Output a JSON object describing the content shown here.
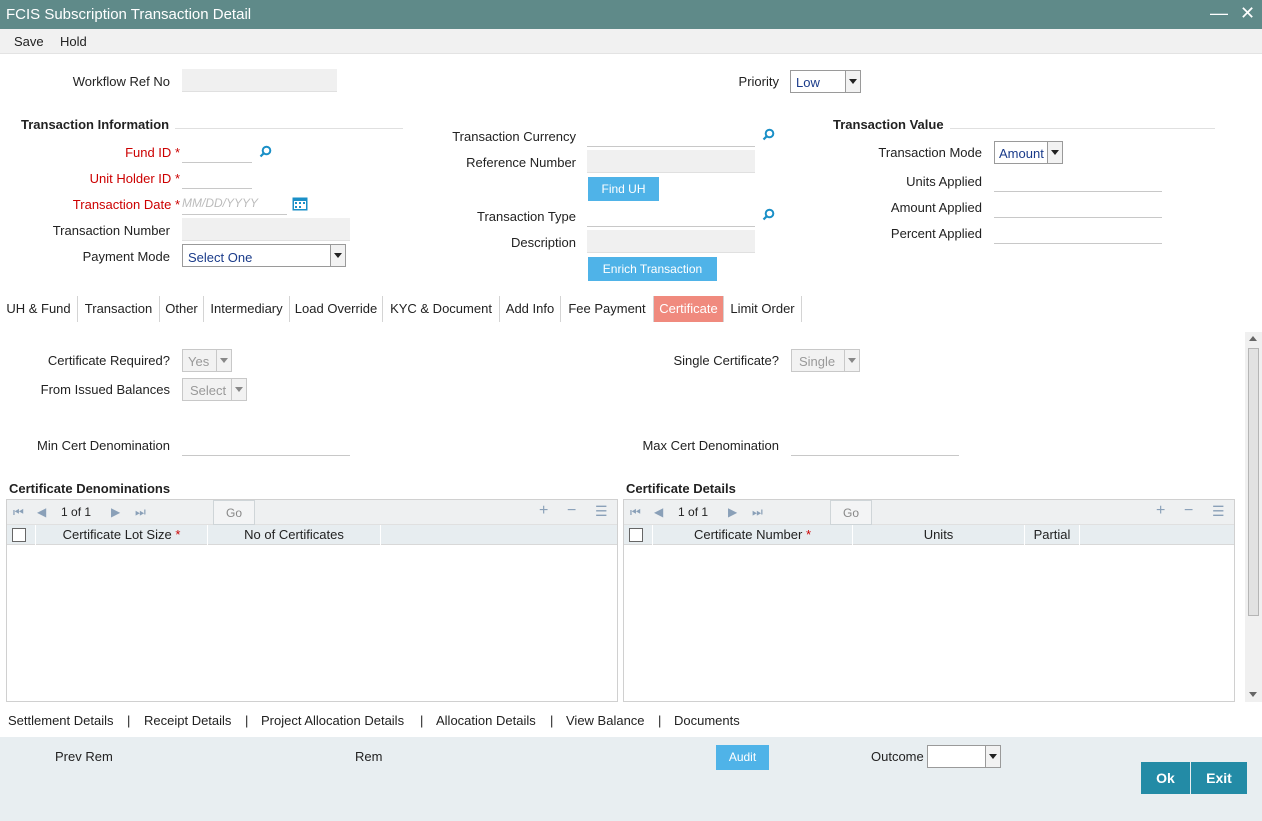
{
  "window": {
    "title": "FCIS Subscription Transaction Detail",
    "minimize_icon": "minimize-icon",
    "close_icon": "close-icon"
  },
  "menu": {
    "save": "Save",
    "hold": "Hold"
  },
  "header": {
    "workflow_ref_label": "Workflow Ref No",
    "workflow_ref_value": "",
    "priority_label": "Priority",
    "priority_value": "Low"
  },
  "txn_info": {
    "section": "Transaction Information",
    "fund_id_label": "Fund ID",
    "unit_holder_label": "Unit Holder ID",
    "txn_date_label": "Transaction Date",
    "txn_date_placeholder": "MM/DD/YYYY",
    "txn_number_label": "Transaction Number",
    "payment_mode_label": "Payment Mode",
    "payment_mode_value": "Select One",
    "required_mark": "*"
  },
  "mid": {
    "currency_label": "Transaction Currency",
    "ref_number_label": "Reference Number",
    "find_uh": "Find UH",
    "txn_type_label": "Transaction Type",
    "description_label": "Description",
    "enrich": "Enrich Transaction"
  },
  "txn_value": {
    "section": "Transaction Value",
    "mode_label": "Transaction Mode",
    "mode_value": "Amount",
    "units_label": "Units Applied",
    "amount_label": "Amount Applied",
    "percent_label": "Percent Applied"
  },
  "tabs": [
    "UH & Fund",
    "Transaction",
    "Other",
    "Intermediary",
    "Load Override",
    "KYC & Document",
    "Add Info",
    "Fee Payment",
    "Certificate",
    "Limit Order"
  ],
  "certificate": {
    "cert_required_label": "Certificate Required?",
    "cert_required_value": "Yes",
    "single_cert_label": "Single Certificate?",
    "single_cert_value": "Single",
    "issued_label": "From Issued Balances",
    "issued_value": "Select",
    "min_label": "Min Cert Denomination",
    "max_label": "Max Cert Denomination"
  },
  "denominations": {
    "title": "Certificate Denominations",
    "page": "1",
    "of": "of",
    "total": "1",
    "go": "Go",
    "columns": [
      "Certificate Lot Size",
      "No of Certificates"
    ]
  },
  "details": {
    "title": "Certificate Details",
    "page": "1",
    "of": "of",
    "total": "1",
    "go": "Go",
    "columns": [
      "Certificate Number",
      "Units",
      "Partial"
    ]
  },
  "bottom_links": [
    "Settlement Details",
    "Receipt Details",
    "Project Allocation Details",
    "Allocation Details",
    "View Balance",
    "Documents"
  ],
  "separator": "|",
  "footer": {
    "prev_rem": "Prev Rem",
    "rem": "Rem",
    "audit": "Audit",
    "outcome_label": "Outcome",
    "outcome_value": "",
    "ok": "Ok",
    "exit": "Exit"
  },
  "colors": {
    "titlebar": "#5f8a89",
    "accent_blue": "#4fb3e8",
    "active_tab": "#f08a7e",
    "ok_button": "#238ba6",
    "required": "#cc0000"
  }
}
